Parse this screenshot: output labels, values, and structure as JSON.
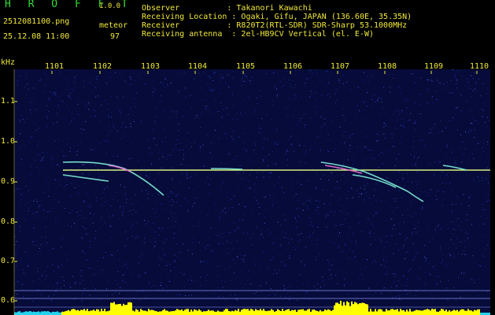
{
  "header": {
    "app_title": "H R O F F T",
    "version": "1.0.0",
    "filename": "2512081100.png",
    "datetime": "25.12.08 11:00",
    "meteor_label": "meteor",
    "meteor_count": "97",
    "observer": "Observer          : Takanori Kawachi",
    "location": "Receiving Location : Ogaki, Gifu, JAPAN (136.60E, 35.35N)",
    "receiver": "Receiver          : R820T2(RTL-SDR) SDR-Sharp 53.1000MHz",
    "antenna": "Receiving antenna  : 2el-HB9CV Vertical (el. E-W)"
  },
  "axis": {
    "y_unit": "kHz",
    "y_ticks": [
      "1.1",
      "1.0",
      "0.9",
      "0.8",
      "0.7",
      "0.6"
    ],
    "x_ticks": [
      "1101",
      "1102",
      "1103",
      "1104",
      "1105",
      "1106",
      "1107",
      "1108",
      "1109",
      "1110"
    ]
  },
  "colors": {
    "background": "#060b3a",
    "label": "#f0e83a",
    "title": "#2fe02f",
    "carrier": "#d6f07a",
    "echo": "#7be6d2",
    "echo_hot": "#e86fd0",
    "level_bar": "#ffff00",
    "level_bar_alt": "#22d4ee"
  }
}
